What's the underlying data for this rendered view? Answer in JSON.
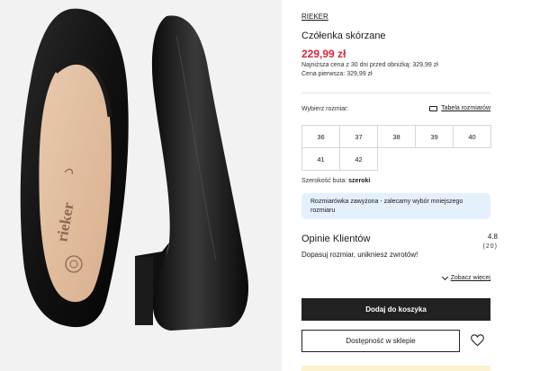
{
  "product": {
    "brand": "RIEKER",
    "name": "Czółenka skórzane",
    "price": "229,99 zł",
    "lowest_price_note": "Najniższa cena z 30 dni przed obniżką: 329,99 zł",
    "first_price_note": "Cena pierwsza: 329,99 zł",
    "image_logo_text": "rieker"
  },
  "sizes": {
    "label": "Wybierz rozmiar:",
    "table_link": "Tabela rozmiarów",
    "options": [
      "36",
      "37",
      "38",
      "39",
      "40",
      "41",
      "42"
    ]
  },
  "width": {
    "label": "Szerokość buta:",
    "value": "szeroki"
  },
  "notice": "Rozmiarówka zawyżona - zalecamy wybór mniejszego rozmiaru",
  "reviews": {
    "title": "Opinie Klientów",
    "rating": "4.8",
    "count": "(20)",
    "fit_text": "Dopasuj rozmiar, unikniesz zwrotów!",
    "see_more": "Zobacz więcej"
  },
  "actions": {
    "add_to_cart": "Dodaj do koszyka",
    "store_availability": "Dostępność w sklepie"
  },
  "icons": [
    "ruler-icon",
    "chevron-down-icon",
    "heart-icon"
  ],
  "colors": {
    "price": "#d8263c",
    "primary_button": "#222222",
    "notice_bg": "#e4f1fc"
  }
}
